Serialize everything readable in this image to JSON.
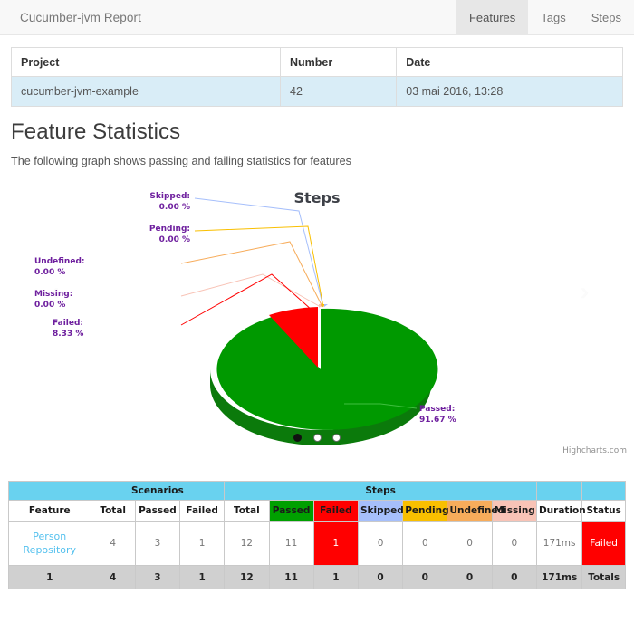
{
  "navbar": {
    "brand": "Cucumber-jvm Report",
    "tabs": [
      {
        "label": "Features",
        "active": true
      },
      {
        "label": "Tags",
        "active": false
      },
      {
        "label": "Steps",
        "active": false
      }
    ]
  },
  "project_table": {
    "headers": [
      "Project",
      "Number",
      "Date"
    ],
    "row": [
      "cucumber-jvm-example",
      "42",
      "03 mai 2016, 13:28"
    ]
  },
  "section": {
    "title": "Feature Statistics",
    "subtitle": "The following graph shows passing and failing statistics for features"
  },
  "chart_data": {
    "type": "pie",
    "title": "Steps",
    "labels": [
      "Passed",
      "Failed",
      "Skipped",
      "Pending",
      "Undefined",
      "Missing"
    ],
    "values": [
      91.67,
      8.33,
      0.0,
      0.0,
      0.0,
      0.0
    ],
    "counts": [
      11,
      1,
      0,
      0,
      0,
      0
    ],
    "value_strings": [
      "91.67 %",
      "8.33 %",
      "0.00 %",
      "0.00 %",
      "0.00 %",
      "0.00 %"
    ],
    "colors": [
      "#009900",
      "#ff0000",
      "#a6bffb",
      "#f9bf00",
      "#f7ac5b",
      "#f8c3b6"
    ],
    "label_color": "#6e1f9e",
    "legend": false,
    "credits": "Highcharts.com",
    "carousel": {
      "prev": "‹",
      "next": "›",
      "dots": 3,
      "active_dot": 0
    }
  },
  "stats_table": {
    "group_headers": [
      {
        "label": "",
        "span": 1
      },
      {
        "label": "Scenarios",
        "span": 3
      },
      {
        "label": "Steps",
        "span": 7
      },
      {
        "label": "",
        "span": 1
      },
      {
        "label": "",
        "span": 1
      }
    ],
    "column_headers": [
      "Feature",
      "Total",
      "Passed",
      "Failed",
      "Total",
      "Passed",
      "Failed",
      "Skipped",
      "Pending",
      "Undefined",
      "Missing",
      "Duration",
      "Status"
    ],
    "rows": [
      {
        "feature": "Person Repository",
        "scenarios_total": "4",
        "scenarios_passed": "3",
        "scenarios_failed": "1",
        "steps_total": "12",
        "steps_passed": "11",
        "steps_failed": "1",
        "steps_skipped": "0",
        "steps_pending": "0",
        "steps_undefined": "0",
        "steps_missing": "0",
        "duration": "171ms",
        "status": "Failed"
      }
    ],
    "totals": {
      "feature": "1",
      "scenarios_total": "4",
      "scenarios_passed": "3",
      "scenarios_failed": "1",
      "steps_total": "12",
      "steps_passed": "11",
      "steps_failed": "1",
      "steps_skipped": "0",
      "steps_pending": "0",
      "steps_undefined": "0",
      "steps_missing": "0",
      "duration": "171ms",
      "status": "Totals"
    }
  }
}
